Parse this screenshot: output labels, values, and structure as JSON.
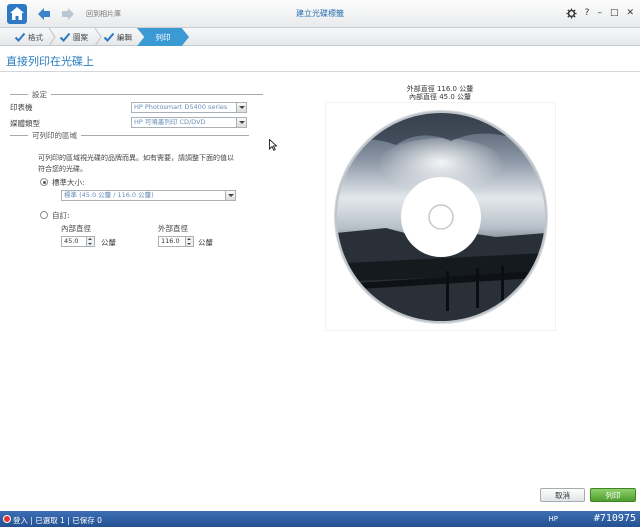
{
  "topbar": {
    "back_label": "回到相片庫",
    "window_title": "建立光碟標籤",
    "help": "?",
    "minimize": "–",
    "maximize": "□",
    "close": "✕"
  },
  "tabs": [
    {
      "label": "格式"
    },
    {
      "label": "圖案"
    },
    {
      "label": "編輯"
    }
  ],
  "active_tab": {
    "label": "列印"
  },
  "page_title": "直接列印在光碟上",
  "settings": {
    "section_label": "設定",
    "printer_label": "印表機",
    "printer_value": "HP Photosmart D5400 series",
    "media_label": "媒體類型",
    "media_value": "HP 可噴墨列印 CD/DVD"
  },
  "printable": {
    "section_label": "可列印的區域",
    "description": "可列印的區域視光碟的品牌而異。如有需要，請調整下面的值以符合您的光碟。",
    "standard_label": "標準大小:",
    "standard_value": "標準 (45.0 公釐  / 116.0 公釐)",
    "standard_selected": true,
    "custom_label": "自訂:",
    "inner_label": "內部直徑",
    "inner_value": "45.0",
    "inner_unit": "公釐",
    "outer_label": "外部直徑",
    "outer_value": "116.0",
    "outer_unit": "公釐"
  },
  "preview": {
    "outer_caption": "外部直徑 116.0 公釐",
    "inner_caption": "內部直徑 45.0 公釐"
  },
  "footer": {
    "cancel": "取消",
    "print": "列印"
  },
  "status": {
    "left": "登入 | 已選取 1 | 已保存 0",
    "hp": "HP",
    "right": "#710975"
  },
  "colors": {
    "accent": "#3b9ad4",
    "title": "#2a7dc0",
    "status_bar": "#2f62a8",
    "print_button": "#5aa83a"
  }
}
